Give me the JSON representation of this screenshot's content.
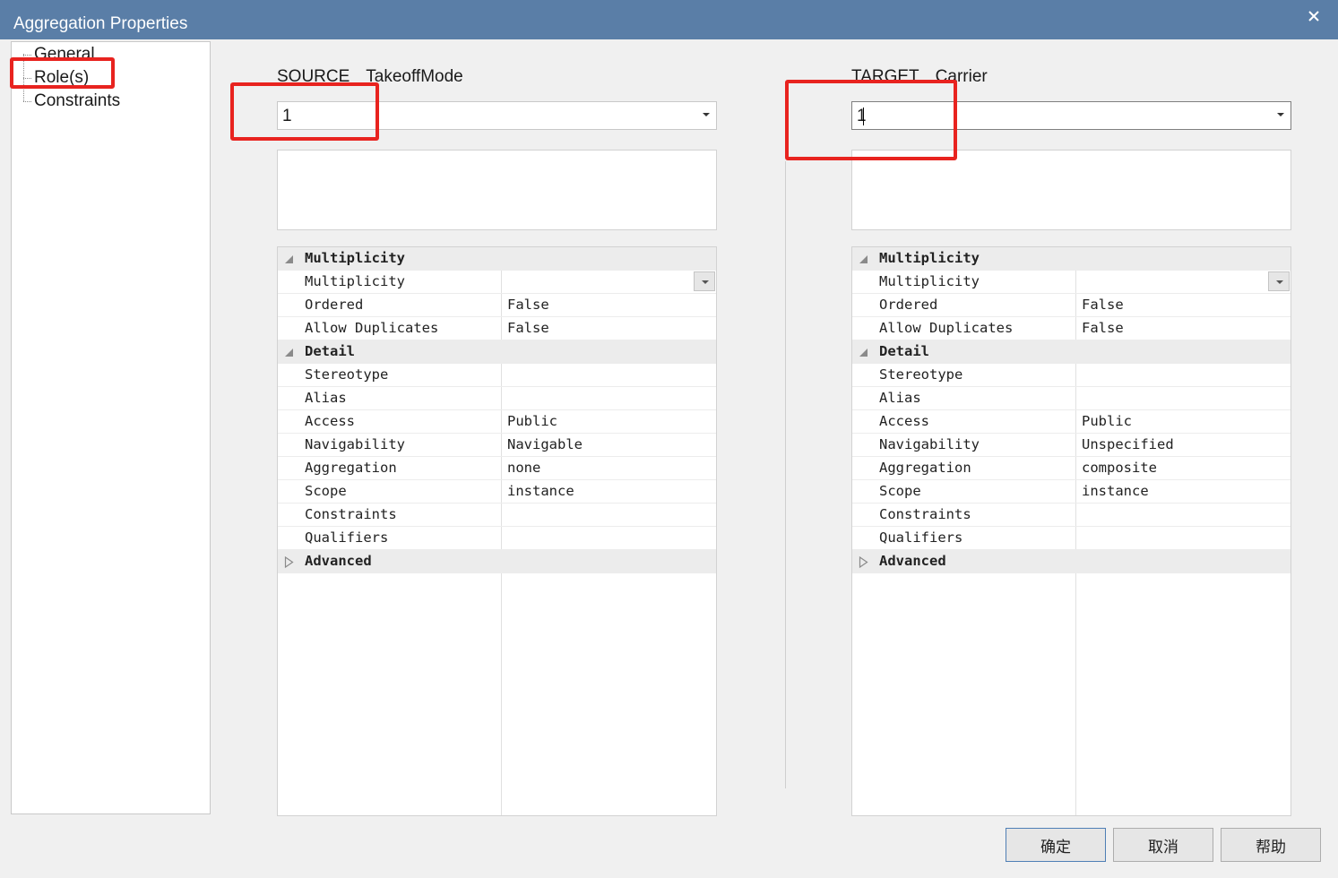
{
  "window": {
    "title": "Aggregation Properties",
    "close_glyph": "✕"
  },
  "nav": {
    "items": [
      {
        "label": "General"
      },
      {
        "label": "Role(s)"
      },
      {
        "label": "Constraints"
      }
    ]
  },
  "source": {
    "heading": "SOURCE",
    "element": "TakeoffMode",
    "role_value": "1",
    "grid": {
      "multiplicity": {
        "category": "Multiplicity",
        "multiplicity_label": "Multiplicity",
        "multiplicity_value": "",
        "ordered_label": "Ordered",
        "ordered_value": "False",
        "allow_duplicates_label": "Allow Duplicates",
        "allow_duplicates_value": "False"
      },
      "detail": {
        "category": "Detail",
        "rows": [
          {
            "name": "Stereotype",
            "value": ""
          },
          {
            "name": "Alias",
            "value": ""
          },
          {
            "name": "Access",
            "value": "Public"
          },
          {
            "name": "Navigability",
            "value": "Navigable"
          },
          {
            "name": "Aggregation",
            "value": "none"
          },
          {
            "name": "Scope",
            "value": "instance"
          },
          {
            "name": "Constraints",
            "value": ""
          },
          {
            "name": "Qualifiers",
            "value": ""
          }
        ]
      },
      "advanced": {
        "category": "Advanced"
      }
    }
  },
  "target": {
    "heading": "TARGET",
    "element": "Carrier",
    "role_value": "1",
    "grid": {
      "multiplicity": {
        "category": "Multiplicity",
        "multiplicity_label": "Multiplicity",
        "multiplicity_value": "",
        "ordered_label": "Ordered",
        "ordered_value": "False",
        "allow_duplicates_label": "Allow Duplicates",
        "allow_duplicates_value": "False"
      },
      "detail": {
        "category": "Detail",
        "rows": [
          {
            "name": "Stereotype",
            "value": ""
          },
          {
            "name": "Alias",
            "value": ""
          },
          {
            "name": "Access",
            "value": "Public"
          },
          {
            "name": "Navigability",
            "value": "Unspecified"
          },
          {
            "name": "Aggregation",
            "value": "composite"
          },
          {
            "name": "Scope",
            "value": "instance"
          },
          {
            "name": "Constraints",
            "value": ""
          },
          {
            "name": "Qualifiers",
            "value": ""
          }
        ]
      },
      "advanced": {
        "category": "Advanced"
      }
    }
  },
  "buttons": {
    "ok": "确定",
    "cancel": "取消",
    "help": "帮助"
  },
  "colors": {
    "titlebar": "#5a7ea7",
    "highlight": "#e8231f",
    "window_bg": "#f0f0f0"
  }
}
